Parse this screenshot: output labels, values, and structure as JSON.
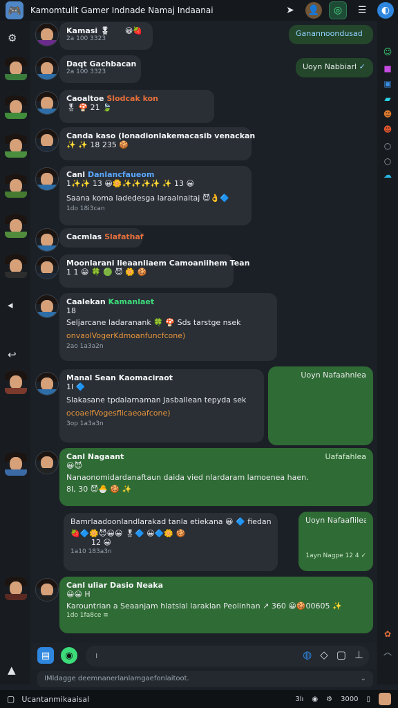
{
  "window": {
    "title": "Kamomtulit Gamer Indnade Namaj Indaanai"
  },
  "top_icons": [
    "pin-icon",
    "profile-avatar-icon",
    "whatsapp-icon",
    "menu-icon",
    "badge-icon"
  ],
  "messages": [
    {
      "name": "Kamasi",
      "name_suffix": "🎖",
      "emoji": "😀🍓",
      "time": "2a 100 3323"
    },
    {
      "name": "Daqt Gachbacan",
      "name_class": "bl",
      "time": "2a 100 3323"
    },
    {
      "name": "Caoaltoe",
      "name_highlight": "Slodcak kon",
      "emoji": "🎖 🍄 21 🍃"
    },
    {
      "name": "Canda kaso (lonadionlakemacasib venackan",
      "emoji": "✨ ✨ 18 235 🍪"
    },
    {
      "name": "Canl",
      "name_highlight": "Danlancfaueom",
      "emoji_row": "1✨✨ 13 😀🌼✨✨✨✨ ✨ 13 😀",
      "text": "Saana koma ladedesga laraalnaitaj 😈👌🔷",
      "time": "1do 18i3can"
    },
    {
      "name": "Cacmlas",
      "name_highlight": "Slafathaf"
    },
    {
      "name": "Moonlarani lieaanliaem Camoaniihem Tean",
      "emoji": "1 1 😀 🍀 🟢 😈 🌼 🍪"
    },
    {
      "name": "Caalekan",
      "name_highlight": "Kamanlaet",
      "emoji_row": "18",
      "text": "Seljarcane ladaranank 🍀 🍄 Sds tarstge nsek",
      "text_orange": "onvaolVogerKdmoanfuncfcone)",
      "time": "2ao 1a3a2n"
    },
    {
      "name": "Manal Sean Kaomaciraot",
      "emoji_row": "1I 🔷",
      "text": "Slakasane tpdalarnaman Jasballean tepyda sek",
      "text_orange": "ocoaelfVogesflicaeoafcone)",
      "time": "3op 1a3a3n"
    },
    {
      "name": "Canl Nagaant",
      "emoji_row": "😀😈",
      "text": "Nanaonomidardanaftaun daida vied nlardaram lamoenea haen.",
      "emoji_line": "8I, 30 😈🐣 🍪 ✨",
      "time_label": "Uafafahlea"
    },
    {
      "name": "Bamrlaadoonlandlarakad tanla etiekana 😀 🔷 fiedan",
      "emoji_row": "🍓🔷🌼😈😀😀 🎖🔷 😀🔷🌼 🍪",
      "emoji_extra": "12 😀",
      "time": "1a10 183a3n"
    },
    {
      "name": "Canl uliar Dasio Neaka",
      "emoji_row": "😀😀 H",
      "text": "Karountrian a Seaanjam hlatslal laraklan Peolinhan ↗ 360 😀🍪00605 ✨",
      "time": "1do 1fa8ce ≡"
    }
  ],
  "outgoing": [
    {
      "text": "Ganannoondusad",
      "check": "✓"
    },
    {
      "text": "Uoyn  Nabbiarl",
      "check": "✓"
    },
    {
      "text": "Uoyn  Nafaahnlea"
    },
    {
      "text": "Uafafahlea"
    },
    {
      "text": "Uoyn  Nafaaflilea",
      "time": "1ayn  Nagpe 12 4 ✓"
    }
  ],
  "composer": {
    "placeholder": "ı",
    "hint": "IMldagge deemnanerlanlamgaefonlaitoot."
  },
  "taskbar": {
    "label": "Ucantanmikaaisal",
    "right_1": "3lı",
    "right_2": "3000"
  }
}
